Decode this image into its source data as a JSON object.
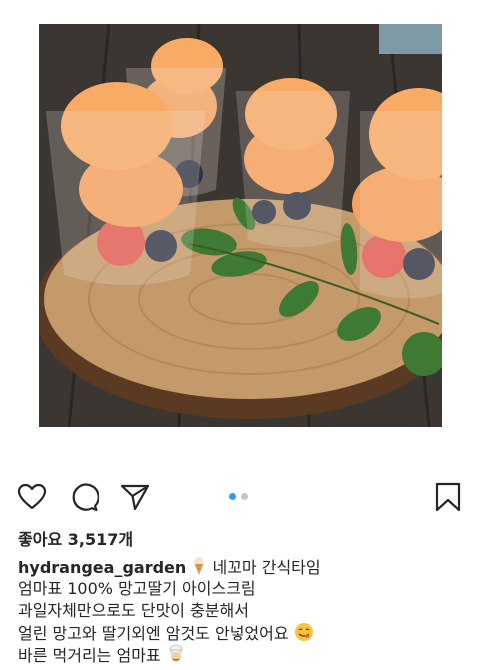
{
  "post": {
    "image_alt": "Mango strawberry ice cream cups on a wooden board",
    "carousel": {
      "total": 2,
      "active": 1
    },
    "likes_text": "좋아요 3,517개",
    "username": "hydrangea_garden",
    "caption_first": "네꼬마 간식타임",
    "caption_lines": [
      "엄마표 100% 망고딸기 아이스크림",
      "과일자체만으로도 단맛이 충분해서",
      "얼린 망고와 딸기외엔 암것도 안넣었어요",
      "바른 먹거리는 엄마표"
    ]
  },
  "actions": {
    "icons": [
      "heart-icon",
      "comment-icon",
      "share-icon",
      "bookmark-icon"
    ]
  },
  "colors": {
    "text": "#262626",
    "dot_active": "#3897f0",
    "dot_inactive": "#c7c7c7",
    "sorbet": "#f6a15d"
  }
}
